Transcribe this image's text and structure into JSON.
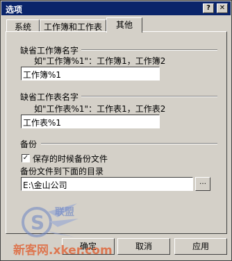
{
  "window": {
    "title": "选项",
    "help_glyph": "?",
    "close_glyph": "✕"
  },
  "tabs": [
    {
      "label": "系统"
    },
    {
      "label": "工作簿和工作表"
    },
    {
      "label": "其他"
    }
  ],
  "workbook": {
    "group_label": "缺省工作簿名字",
    "hint": "如\"工作簿%1\"：工作簿1，工作簿2",
    "value": "工作簿%1"
  },
  "worksheet": {
    "group_label": "缺省工作表名字",
    "hint": "如\"工作表%1\"：工作表1，工作表2",
    "value": "工作表%1"
  },
  "backup": {
    "group_label": "备份",
    "checkbox_label": "保存的时候备份文件",
    "checked": true,
    "dir_label": "备份文件到下面的目录",
    "dir_value": "E:\\金山公司",
    "browse_glyph": "…"
  },
  "buttons": {
    "ok": "确定",
    "cancel": "取消",
    "apply": "应用"
  },
  "watermark": {
    "text": "新客网.xker.com",
    "cn": "联盟"
  }
}
